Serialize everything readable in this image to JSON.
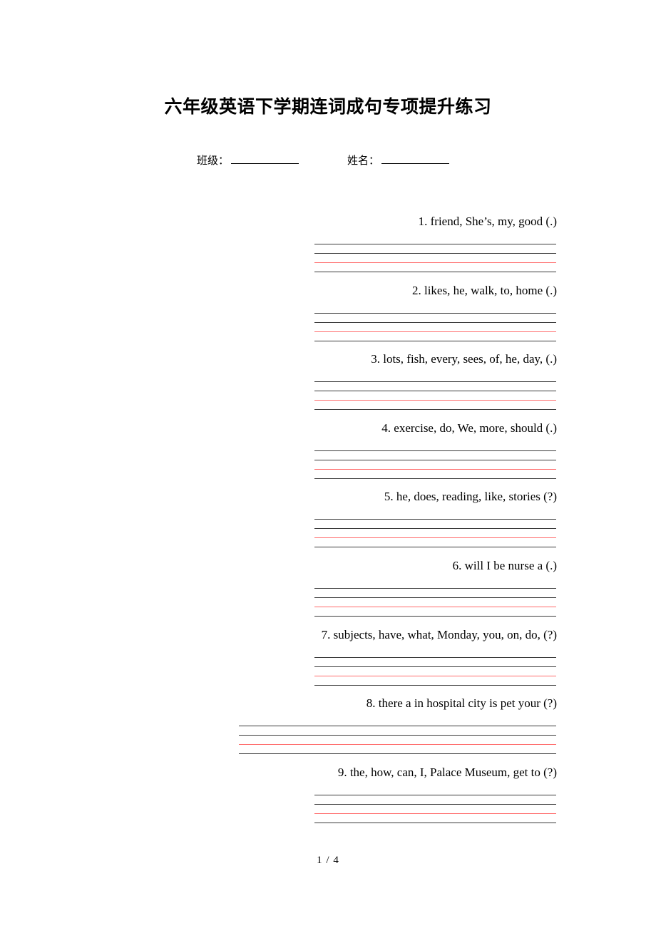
{
  "document": {
    "title": "六年级英语下学期连词成句专项提升练习",
    "footer": "1 / 4"
  },
  "info": {
    "class_label": "班级：",
    "name_label": "姓名："
  },
  "colors": {
    "rule_black": "#3a3a3a",
    "rule_red": "#ff6b6b",
    "text": "#000000",
    "page_background": "#ffffff"
  },
  "staff": {
    "line_count": 4,
    "line_colors": [
      "#3a3a3a",
      "#3a3a3a",
      "#ff6b6b",
      "#3a3a3a"
    ]
  },
  "questions": [
    {
      "number": "1.",
      "text": "1. friend, She’s, my, good (.)",
      "wide": false
    },
    {
      "number": "2.",
      "text": "2. likes, he, walk, to, home (.)",
      "wide": false
    },
    {
      "number": "3.",
      "text": "3. lots, fish, every, sees, of, he, day, (.)",
      "wide": false
    },
    {
      "number": "4.",
      "text": "4. exercise, do, We, more, should (.)",
      "wide": false
    },
    {
      "number": "5.",
      "text": "5. he, does, reading, like, stories (?)",
      "wide": false
    },
    {
      "number": "6.",
      "text": "6. will   I   be   nurse   a (.)",
      "wide": false
    },
    {
      "number": "7.",
      "text": "7. subjects, have, what, Monday, you, on, do, (?)",
      "wide": false
    },
    {
      "number": "8.",
      "text": "8. there  a  in  hospital  city  is  pet  your (?)",
      "wide": true
    },
    {
      "number": "9.",
      "text": "9. the, how, can, I, Palace Museum, get to (?)",
      "wide": false
    }
  ]
}
